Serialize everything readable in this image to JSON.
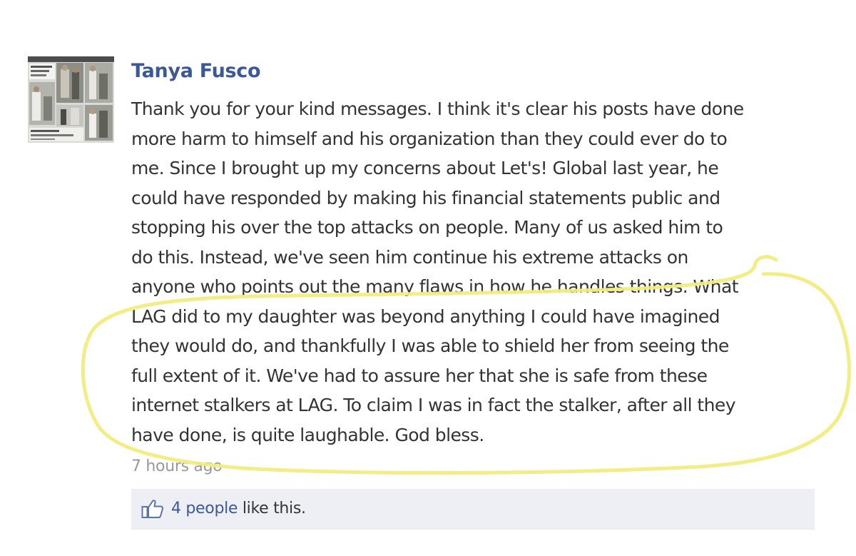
{
  "comment": {
    "author": "Tanya Fusco",
    "lines": [
      "Thank you for your kind messages. I think it's clear his posts have done",
      "more harm to himself and his organization than they could ever do to",
      "me. Since I brought up my concerns about Let's! Global last year, he",
      "could have responded by making his financial statements public and",
      "stopping his over the top attacks on people. Many of us asked him to",
      "do this. Instead, we've seen him continue his extreme attacks on",
      "anyone who points out the many flaws in how he handles things. What",
      "LAG did to my daughter was beyond anything I could have imagined",
      "they would do, and thankfully I was able to shield her from seeing the",
      "full extent of it. We've had to assure her that she is safe from these",
      "internet stalkers at LAG. To claim I was in fact the stalker, after all they",
      "have done, is quite laughable. God bless."
    ],
    "timestamp": "7 hours ago"
  },
  "likes": {
    "people_link": "4 people",
    "suffix": " like this.",
    "icon": "thumbs-up-icon"
  },
  "colors": {
    "author_link": "#3b5998",
    "body_text": "#333333",
    "timestamp": "#999999",
    "like_bar_bg": "#edeff4",
    "highlight_stroke": "#f2ec7e"
  }
}
